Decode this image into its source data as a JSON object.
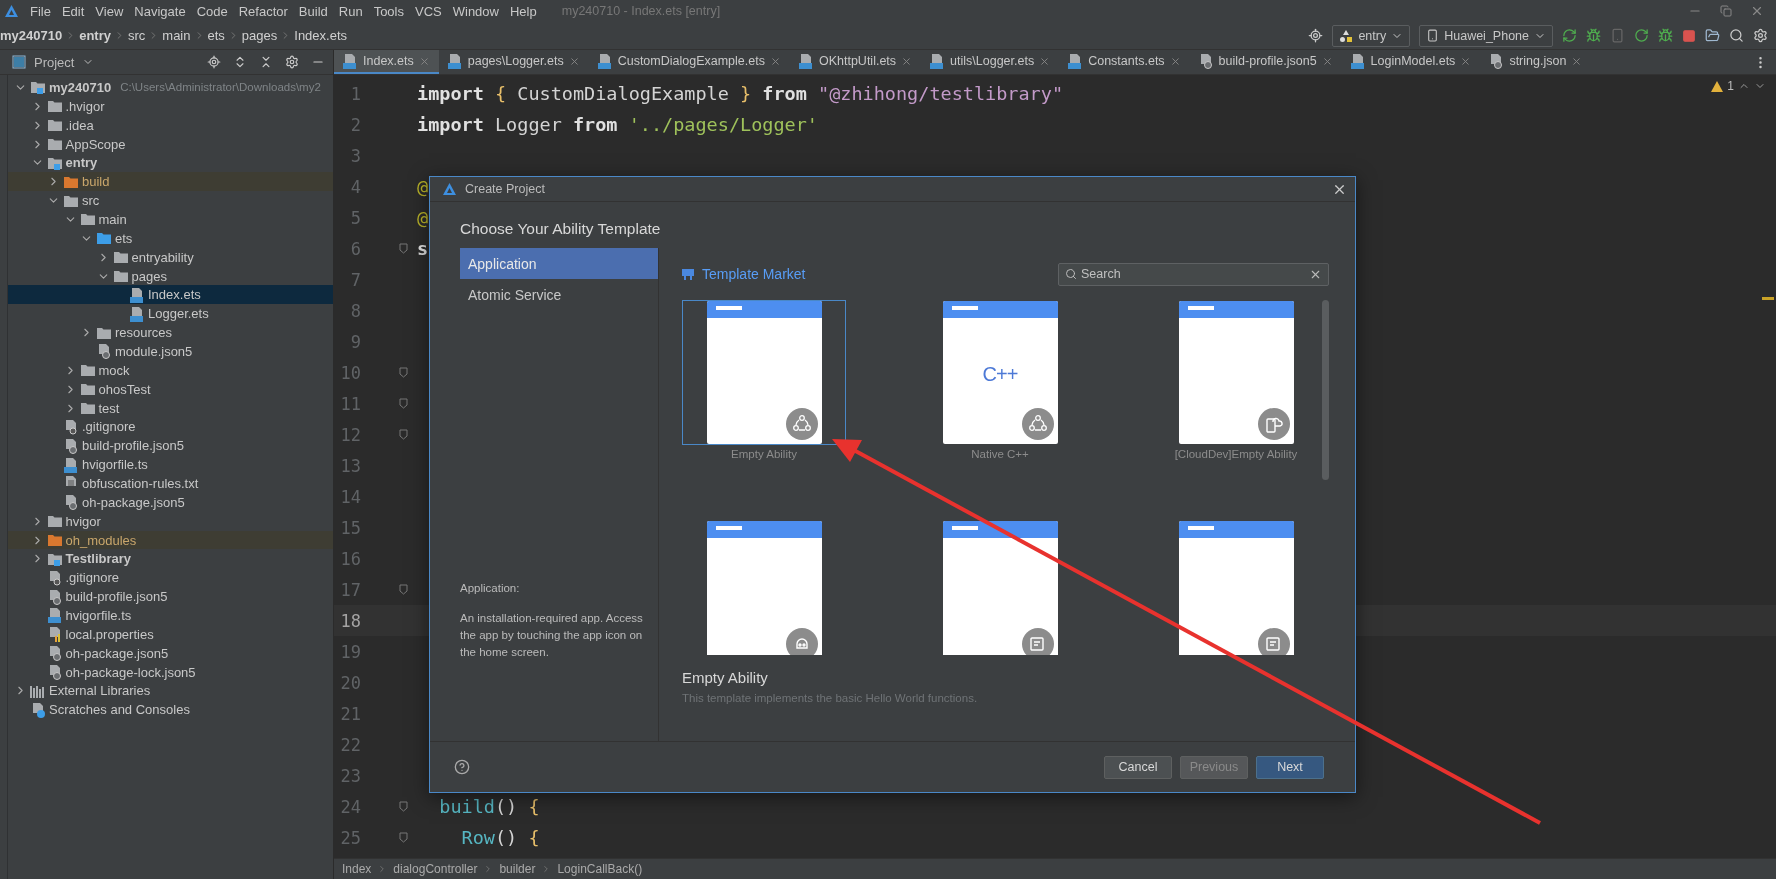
{
  "menu": [
    "File",
    "Edit",
    "View",
    "Navigate",
    "Code",
    "Refactor",
    "Build",
    "Run",
    "Tools",
    "VCS",
    "Window",
    "Help"
  ],
  "window_title": "my240710 - Index.ets [entry]",
  "breadcrumb": [
    {
      "label": "my240710",
      "bold": true
    },
    {
      "label": "entry",
      "bold": true
    },
    {
      "label": "src",
      "bold": false
    },
    {
      "label": "main",
      "bold": false
    },
    {
      "label": "ets",
      "bold": false
    },
    {
      "label": "pages",
      "bold": false
    },
    {
      "label": "Index.ets",
      "bold": false
    }
  ],
  "run_config": {
    "module": "entry",
    "device": "Huawei_Phone"
  },
  "project_panel": {
    "title": "Project",
    "tree": [
      {
        "label": "my240710",
        "hint": "C:\\Users\\Administrator\\Downloads\\my2",
        "kind": "module",
        "expanded": true,
        "selected": false,
        "excluded": false,
        "children": [
          {
            "label": ".hvigor",
            "kind": "folder",
            "expanded": false,
            "selected": false,
            "excluded": false
          },
          {
            "label": ".idea",
            "kind": "folder",
            "expanded": false,
            "selected": false,
            "excluded": false
          },
          {
            "label": "AppScope",
            "kind": "folder",
            "expanded": false,
            "selected": false,
            "excluded": false
          },
          {
            "label": "entry",
            "kind": "module",
            "expanded": true,
            "selected": false,
            "excluded": false,
            "children": [
              {
                "label": "build",
                "kind": "folder",
                "expanded": false,
                "selected": false,
                "excluded": true
              },
              {
                "label": "src",
                "kind": "folder",
                "expanded": true,
                "selected": false,
                "excluded": false,
                "children": [
                  {
                    "label": "main",
                    "kind": "folder",
                    "expanded": true,
                    "selected": false,
                    "excluded": false,
                    "children": [
                      {
                        "label": "ets",
                        "kind": "source_folder",
                        "expanded": true,
                        "selected": false,
                        "excluded": false,
                        "children": [
                          {
                            "label": "entryability",
                            "kind": "folder",
                            "expanded": false,
                            "selected": false,
                            "excluded": false
                          },
                          {
                            "label": "pages",
                            "kind": "folder",
                            "expanded": true,
                            "selected": false,
                            "excluded": false,
                            "children": [
                              {
                                "label": "Index.ets",
                                "kind": "ets_file",
                                "selected": true,
                                "excluded": false
                              },
                              {
                                "label": "Logger.ets",
                                "kind": "ets_file",
                                "selected": false,
                                "excluded": false
                              }
                            ]
                          }
                        ]
                      },
                      {
                        "label": "resources",
                        "kind": "folder",
                        "expanded": false,
                        "selected": false,
                        "excluded": false
                      },
                      {
                        "label": "module.json5",
                        "kind": "config_file",
                        "selected": false,
                        "excluded": false
                      }
                    ]
                  },
                  {
                    "label": "mock",
                    "kind": "folder",
                    "expanded": false,
                    "selected": false,
                    "excluded": false
                  },
                  {
                    "label": "ohosTest",
                    "kind": "folder",
                    "expanded": false,
                    "selected": false,
                    "excluded": false
                  },
                  {
                    "label": "test",
                    "kind": "folder",
                    "expanded": false,
                    "selected": false,
                    "excluded": false
                  }
                ]
              },
              {
                "label": ".gitignore",
                "kind": "ignore_file",
                "selected": false,
                "excluded": false
              },
              {
                "label": "build-profile.json5",
                "kind": "config_file",
                "selected": false,
                "excluded": false
              },
              {
                "label": "hvigorfile.ts",
                "kind": "ts_file",
                "selected": false,
                "excluded": false
              },
              {
                "label": "obfuscation-rules.txt",
                "kind": "text_file",
                "selected": false,
                "excluded": false
              },
              {
                "label": "oh-package.json5",
                "kind": "config_file",
                "selected": false,
                "excluded": false
              }
            ]
          },
          {
            "label": "hvigor",
            "kind": "folder",
            "expanded": false,
            "selected": false,
            "excluded": false
          },
          {
            "label": "oh_modules",
            "kind": "folder",
            "expanded": false,
            "selected": false,
            "excluded": true
          },
          {
            "label": "Testlibrary",
            "kind": "module",
            "expanded": false,
            "selected": false,
            "excluded": false
          },
          {
            "label": ".gitignore",
            "kind": "ignore_file",
            "selected": false,
            "excluded": false
          },
          {
            "label": "build-profile.json5",
            "kind": "config_file",
            "selected": false,
            "excluded": false
          },
          {
            "label": "hvigorfile.ts",
            "kind": "ts_file",
            "selected": false,
            "excluded": false
          },
          {
            "label": "local.properties",
            "kind": "properties_file",
            "selected": false,
            "excluded": false
          },
          {
            "label": "oh-package.json5",
            "kind": "config_file",
            "selected": false,
            "excluded": false
          },
          {
            "label": "oh-package-lock.json5",
            "kind": "config_file",
            "selected": false,
            "excluded": false
          }
        ]
      },
      {
        "label": "External Libraries",
        "kind": "libraries",
        "expanded": false,
        "selected": false,
        "excluded": false
      },
      {
        "label": "Scratches and Consoles",
        "kind": "scratches",
        "selected": false,
        "excluded": false
      }
    ]
  },
  "editor_tabs": [
    {
      "label": "Index.ets",
      "kind": "ets",
      "selected": true
    },
    {
      "label": "pages\\Logger.ets",
      "kind": "ets",
      "selected": false
    },
    {
      "label": "CustomDialogExample.ets",
      "kind": "ets",
      "selected": false
    },
    {
      "label": "OKhttpUtil.ets",
      "kind": "ets",
      "selected": false
    },
    {
      "label": "utils\\Logger.ets",
      "kind": "ets",
      "selected": false
    },
    {
      "label": "Constants.ets",
      "kind": "ets",
      "selected": false
    },
    {
      "label": "build-profile.json5",
      "kind": "config",
      "selected": false
    },
    {
      "label": "LoginModel.ets",
      "kind": "ets",
      "selected": false
    },
    {
      "label": "string.json",
      "kind": "config",
      "selected": false
    }
  ],
  "editor": {
    "warning_count": "1",
    "lines": [
      {
        "number": "1",
        "current": false,
        "fold": false,
        "tokens": [
          {
            "text": "import",
            "kind": "keyword"
          },
          {
            "text": " {",
            "kind": "brace"
          },
          {
            "text": " CustomDialogExample ",
            "kind": "plain"
          },
          {
            "text": "}",
            "kind": "brace"
          },
          {
            "text": " from",
            "kind": "keyword"
          },
          {
            "text": " \"@zhihong/testlibrary\"",
            "kind": "module_string"
          }
        ]
      },
      {
        "number": "2",
        "current": false,
        "fold": false,
        "tokens": [
          {
            "text": "import",
            "kind": "keyword"
          },
          {
            "text": " Logger ",
            "kind": "plain"
          },
          {
            "text": "from",
            "kind": "keyword"
          },
          {
            "text": " '../pages/Logger'",
            "kind": "string"
          }
        ]
      },
      {
        "number": "3",
        "current": false,
        "fold": false
      },
      {
        "number": "4",
        "current": false,
        "fold": false,
        "tokens": [
          {
            "text": "@",
            "kind": "annotation"
          }
        ]
      },
      {
        "number": "5",
        "current": false,
        "fold": false,
        "tokens": [
          {
            "text": "@",
            "kind": "annotation"
          }
        ]
      },
      {
        "number": "6",
        "current": false,
        "fold": true,
        "tokens": [
          {
            "text": "s",
            "kind": "keyword"
          }
        ]
      },
      {
        "number": "7",
        "current": false,
        "fold": false
      },
      {
        "number": "8",
        "current": false,
        "fold": false
      },
      {
        "number": "9",
        "current": false,
        "fold": false
      },
      {
        "number": "10",
        "current": false,
        "fold": true
      },
      {
        "number": "11",
        "current": false,
        "fold": true
      },
      {
        "number": "12",
        "current": false,
        "fold": true
      },
      {
        "number": "13",
        "current": false,
        "fold": false
      },
      {
        "number": "14",
        "current": false,
        "fold": false
      },
      {
        "number": "15",
        "current": false,
        "fold": false
      },
      {
        "number": "16",
        "current": false,
        "fold": false
      },
      {
        "number": "17",
        "current": false,
        "fold": true
      },
      {
        "number": "18",
        "current": true,
        "fold": false
      },
      {
        "number": "19",
        "current": false,
        "fold": false
      },
      {
        "number": "20",
        "current": false,
        "fold": false
      },
      {
        "number": "21",
        "current": false,
        "fold": false
      },
      {
        "number": "22",
        "current": false,
        "fold": false
      },
      {
        "number": "23",
        "current": false,
        "fold": false
      },
      {
        "number": "24",
        "current": false,
        "fold": true,
        "tokens": [
          {
            "text": "  build",
            "kind": "func"
          },
          {
            "text": "() ",
            "kind": "plain"
          },
          {
            "text": "{",
            "kind": "brace"
          }
        ]
      },
      {
        "number": "25",
        "current": false,
        "fold": true,
        "tokens": [
          {
            "text": "    Row",
            "kind": "func"
          },
          {
            "text": "() ",
            "kind": "plain"
          },
          {
            "text": "{",
            "kind": "brace"
          }
        ]
      }
    ]
  },
  "status_breadcrumb": [
    "Index",
    "dialogController",
    "builder",
    "LoginCallBack()"
  ],
  "dialog": {
    "title": "Create Project",
    "heading": "Choose Your Ability Template",
    "categories": [
      {
        "label": "Application",
        "selected": true
      },
      {
        "label": "Atomic Service",
        "selected": false
      }
    ],
    "category_title": "Application:",
    "category_description": "An installation-required app. Access the app by touching the app icon on the home screen.",
    "market_link": "Template Market",
    "search": {
      "placeholder": "Search"
    },
    "templates": [
      {
        "name": "Empty Ability",
        "selected": true,
        "kind": "nodes"
      },
      {
        "name": "Native C++",
        "preview_label": "C++",
        "selected": false,
        "kind": "nodes"
      },
      {
        "name": "[CloudDev]Empty Ability",
        "selected": false,
        "kind": "cloud"
      },
      {
        "selected": false,
        "kind": "robot"
      },
      {
        "selected": false,
        "kind": "card"
      },
      {
        "selected": false,
        "kind": "card"
      }
    ],
    "detail_name": "Empty Ability",
    "detail_description": "This template implements the basic Hello World functions.",
    "buttons": [
      {
        "label": "Cancel",
        "kind": "secondary",
        "disabled": false
      },
      {
        "label": "Previous",
        "kind": "secondary",
        "disabled": true
      },
      {
        "label": "Next",
        "kind": "primary",
        "disabled": false
      }
    ]
  }
}
